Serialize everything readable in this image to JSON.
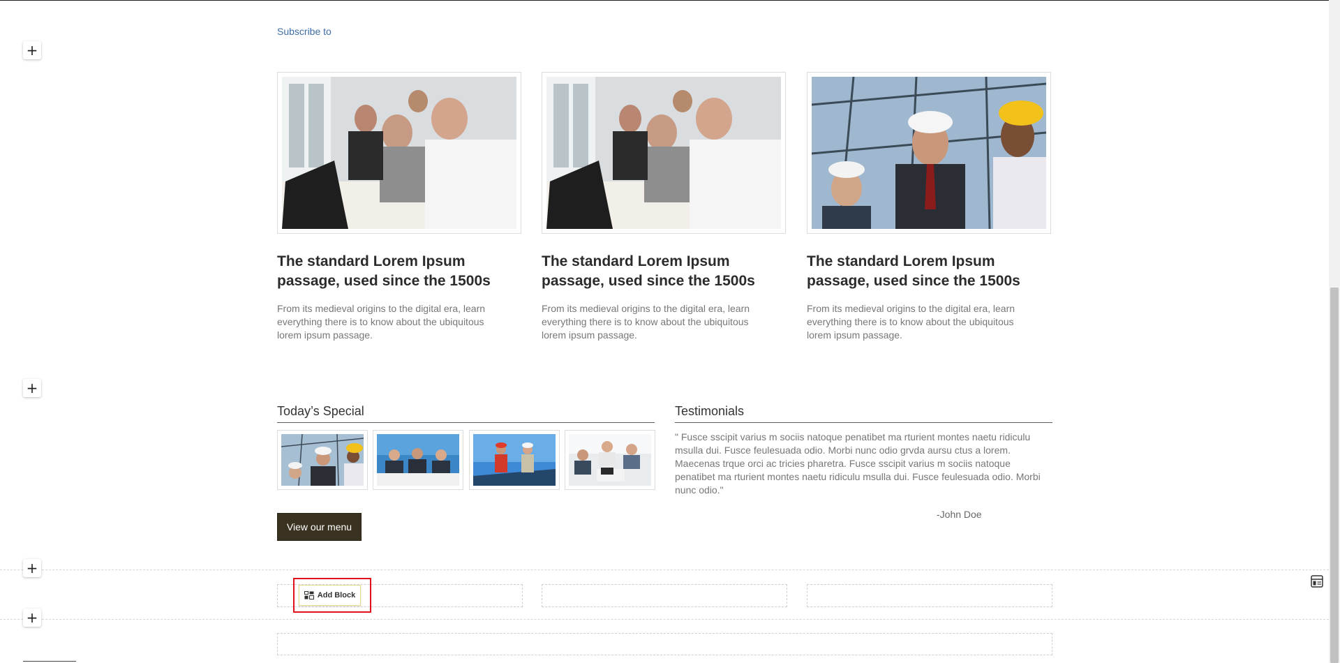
{
  "subscribe_link": "Subscribe to",
  "cards": [
    {
      "image": "business-meeting-photo",
      "title": "The standard Lorem Ipsum passage, used since the 1500s",
      "description": "From its medieval origins to the digital era, learn everything there is to know about the ubiquitous lorem ipsum passage."
    },
    {
      "image": "business-meeting-photo",
      "title": "The standard Lorem Ipsum passage, used since the 1500s",
      "description": "From its medieval origins to the digital era, learn everything there is to know about the ubiquitous lorem ipsum passage."
    },
    {
      "image": "construction-team-photo",
      "title": "The standard Lorem Ipsum passage, used since the 1500s",
      "description": "From its medieval origins to the digital era, learn everything there is to know about the ubiquitous lorem ipsum passage."
    }
  ],
  "todays_special": {
    "title": "Today’s Special",
    "thumbnails": [
      "construction-team-photo",
      "office-meeting-photo",
      "handshake-solar-photo",
      "team-laptops-photo"
    ],
    "button_label": "View our menu"
  },
  "testimonials": {
    "title": "Testimonials",
    "quote": "\" Fusce sscipit varius m sociis natoque penatibet ma rturient montes naetu ridiculu msulla dui. Fusce feulesuada odio. Morbi nunc odio grvda aursu ctus a lorem. Maecenas trque orci ac tricies pharetra. Fusce sscipit varius m sociis natoque penatibet ma rturient montes naetu ridiculu msulla dui. Fusce feulesuada odio. Morbi nunc odio.\"",
    "author": "-John Doe"
  },
  "editor": {
    "add_block_label": "Add Block",
    "add_section_symbol": "+"
  },
  "colors": {
    "link": "#3e6da5",
    "button_bg": "#3a3220",
    "highlight": "#e3111b"
  }
}
